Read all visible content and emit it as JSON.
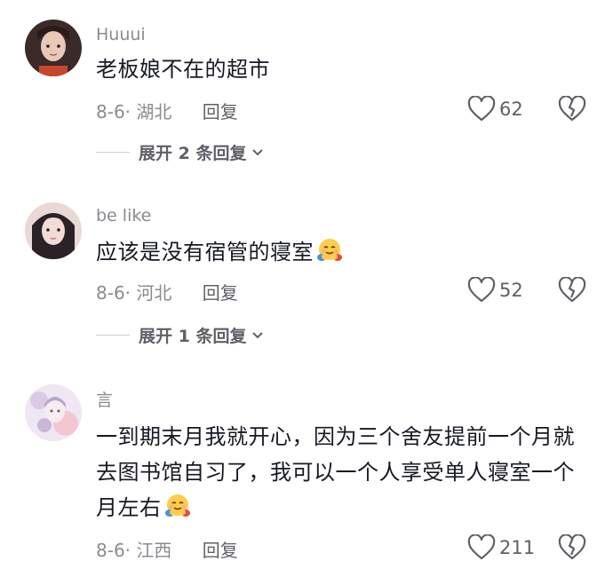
{
  "comments": [
    {
      "username": "Huuui",
      "text": "老板娘不在的超市",
      "date_location": "8-6· 湖北",
      "reply_label": "回复",
      "likes": "62",
      "expand_label": "展开 2 条回复",
      "avatar_colors": [
        "#3a2a2a",
        "#e8c9b8",
        "#c9462f"
      ]
    },
    {
      "username": "be like",
      "text": "应该是没有宿管的寝室",
      "has_emoji": true,
      "date_location": "8-6· 河北",
      "reply_label": "回复",
      "likes": "52",
      "expand_label": "展开 1 条回复",
      "avatar_colors": [
        "#2a2226",
        "#f1dcd6",
        "#d9b8b5"
      ]
    },
    {
      "username": "言",
      "text": "一到期末月我就开心，因为三个舍友提前一个月就去图书馆自习了，我可以一个人享受单人寝室一个月左右",
      "has_emoji": true,
      "date_location": "8-6· 江西",
      "reply_label": "回复",
      "likes": "211",
      "avatar_colors": [
        "#efe7f3",
        "#c9b7d9",
        "#f3c6d2"
      ]
    }
  ],
  "emoji_name": "hugging-face-emoji"
}
